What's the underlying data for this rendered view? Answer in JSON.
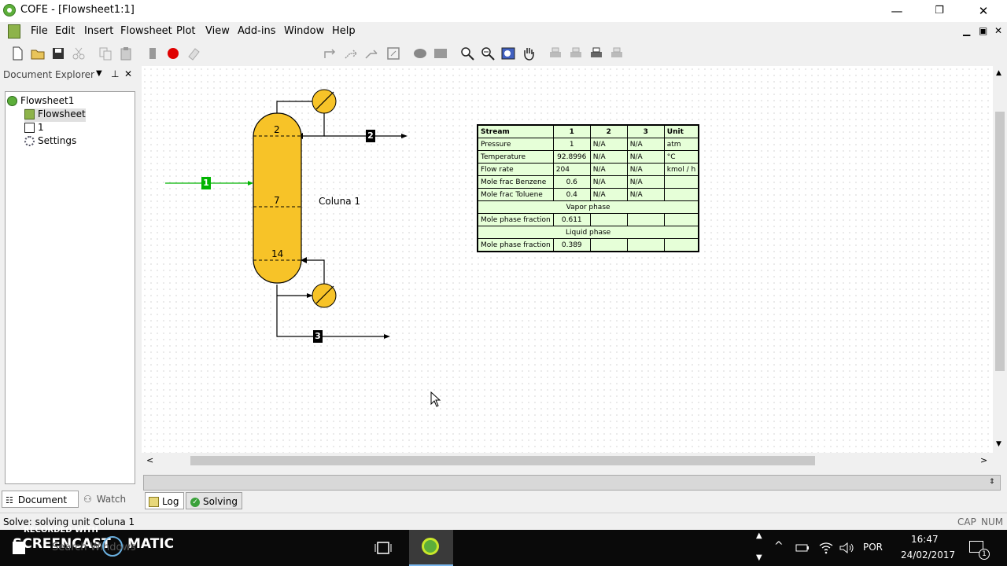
{
  "window": {
    "title": "COFE - [Flowsheet1:1]",
    "minimize": "—",
    "restore": "❐",
    "close": "✕"
  },
  "menu": {
    "items": [
      "File",
      "Edit",
      "Insert",
      "Flowsheet",
      "Plot",
      "View",
      "Add-ins",
      "Window",
      "Help"
    ],
    "mdi_min": "▁",
    "mdi_restore": "▣",
    "mdi_close": "✕"
  },
  "toolbar": {
    "flowsheet_select": "default"
  },
  "explorer": {
    "title": "Document Explorer",
    "tree": [
      {
        "label": "Flowsheet1"
      },
      {
        "label": "Flowsheet"
      },
      {
        "label": "1"
      },
      {
        "label": "Settings"
      }
    ],
    "tabs": {
      "document": "Document ...",
      "watch": "Watch"
    }
  },
  "flowsheet": {
    "unit_name": "Coluna 1",
    "stages": {
      "top": "2",
      "feed": "7",
      "bottom": "14"
    },
    "streams": {
      "feed": "1",
      "distillate": "2",
      "bottoms": "3"
    }
  },
  "stream_table": {
    "headers": [
      "Stream",
      "1",
      "2",
      "3",
      "Unit"
    ],
    "rows": [
      [
        "Pressure",
        "1",
        "N/A",
        "N/A",
        "atm"
      ],
      [
        "Temperature",
        "92.8996",
        "N/A",
        "N/A",
        "°C"
      ],
      [
        "Flow rate",
        "204",
        "N/A",
        "N/A",
        "kmol / h"
      ],
      [
        "Mole frac Benzene",
        "0.6",
        "N/A",
        "N/A",
        ""
      ],
      [
        "Mole frac Toluene",
        "0.4",
        "N/A",
        "N/A",
        ""
      ]
    ],
    "vapor_section": "Vapor phase",
    "vapor_row": [
      "Mole phase fraction",
      "0.611",
      "",
      "",
      ""
    ],
    "liquid_section": "Liquid phase",
    "liquid_row": [
      "Mole phase fraction",
      "0.389",
      "",
      "",
      ""
    ]
  },
  "bottom_tabs": {
    "log": "Log",
    "solving": "Solving"
  },
  "status": {
    "text": "Solve: solving unit Coluna 1",
    "caps": "CAP",
    "num": "NUM"
  },
  "taskbar": {
    "watermark_top": "RECORDED WITH",
    "watermark": "SCREENCAST",
    "watermark2": "MATIC",
    "search": "Search Windows",
    "language": "POR",
    "time": "16:47",
    "date": "24/02/2017",
    "notifications": "1"
  },
  "colors": {
    "column_fill": "#f7c328",
    "table_fill": "#e6ffd8",
    "feed_stream": "#00b400",
    "taskbar": "#0a0a0a"
  }
}
